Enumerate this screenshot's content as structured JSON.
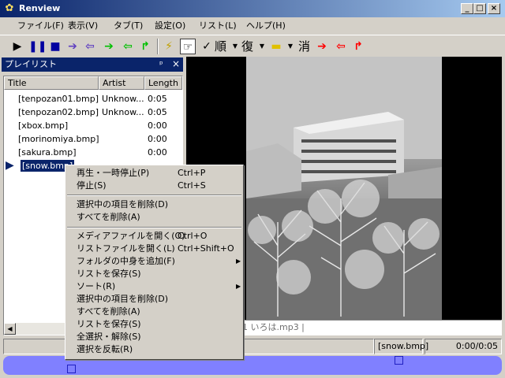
{
  "window": {
    "title": "Renview",
    "icon": "app-icon"
  },
  "menu": [
    "ファイル(F)",
    "表示(V)",
    "タブ(T)",
    "設定(O)",
    "リスト(L)",
    "ヘルプ(H)"
  ],
  "toolbar": {
    "order_label": "順",
    "repeat_label": "復",
    "clear_label": "消",
    "colors": {
      "blue": "#0000a0",
      "purple": "#6040c0",
      "green": "#00c000",
      "red": "#ff0000"
    }
  },
  "playlist": {
    "title": "プレイリスト",
    "pin_glyph": "ᵖ",
    "close_glyph": "×",
    "columns": [
      "Title",
      "Artist",
      "Length"
    ],
    "rows": [
      {
        "title": "[tenpozan01.bmp]",
        "artist": "Unknow...",
        "length": "0:05"
      },
      {
        "title": "[tenpozan02.bmp]",
        "artist": "Unknow...",
        "length": "0:05"
      },
      {
        "title": "[xbox.bmp]",
        "artist": "",
        "length": "0:00"
      },
      {
        "title": "[morinomiya.bmp]",
        "artist": "",
        "length": "0:00"
      },
      {
        "title": "[sakura.bmp]",
        "artist": "",
        "length": "0:00"
      },
      {
        "title": "[snow.bmp]",
        "artist": "",
        "length": "",
        "selected": true
      }
    ]
  },
  "info": {
    "text": "1  いろは.mp3 |"
  },
  "status": {
    "file": "[snow.bmp]",
    "time": "0:00/0:05"
  },
  "context_menu": {
    "group1": [
      {
        "label": "再生・一時停止(P)",
        "shortcut": "Ctrl+P"
      },
      {
        "label": "停止(S)",
        "shortcut": "Ctrl+S"
      }
    ],
    "group2": [
      {
        "label": "選択中の項目を削除(D)"
      },
      {
        "label": "すべてを削除(A)"
      }
    ],
    "group3": [
      {
        "label": "メディアファイルを開く(O)",
        "shortcut": "Ctrl+O"
      },
      {
        "label": "リストファイルを開く(L)",
        "shortcut": "Ctrl+Shift+O"
      },
      {
        "label": "フォルダの中身を追加(F)",
        "submenu": true
      },
      {
        "label": "リストを保存(S)"
      },
      {
        "label": "ソート(R)",
        "submenu": true
      },
      {
        "label": "選択中の項目を削除(D)"
      },
      {
        "label": "すべてを削除(A)"
      },
      {
        "label": "リストを保存(S)"
      },
      {
        "label": "全選択・解除(S)"
      },
      {
        "label": "選択を反転(R)"
      }
    ]
  }
}
